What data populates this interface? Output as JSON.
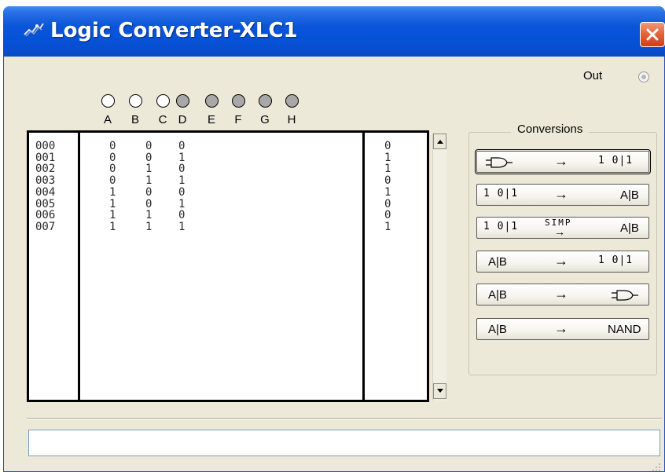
{
  "window": {
    "title": "Logic Converter-XLC1"
  },
  "output": {
    "label": "Out"
  },
  "inputs": [
    {
      "letter": "A",
      "state": "off"
    },
    {
      "letter": "B",
      "state": "off"
    },
    {
      "letter": "C",
      "state": "off"
    },
    {
      "letter": "D",
      "state": "on"
    },
    {
      "letter": "E",
      "state": "on"
    },
    {
      "letter": "F",
      "state": "on"
    },
    {
      "letter": "G",
      "state": "on"
    },
    {
      "letter": "H",
      "state": "on"
    }
  ],
  "truth_table": {
    "rows": [
      {
        "index": "000",
        "a": "0",
        "b": "0",
        "c": "0",
        "out": "0"
      },
      {
        "index": "001",
        "a": "0",
        "b": "0",
        "c": "1",
        "out": "1"
      },
      {
        "index": "002",
        "a": "0",
        "b": "1",
        "c": "0",
        "out": "1"
      },
      {
        "index": "003",
        "a": "0",
        "b": "1",
        "c": "1",
        "out": "0"
      },
      {
        "index": "004",
        "a": "1",
        "b": "0",
        "c": "0",
        "out": "1"
      },
      {
        "index": "005",
        "a": "1",
        "b": "0",
        "c": "1",
        "out": "0"
      },
      {
        "index": "006",
        "a": "1",
        "b": "1",
        "c": "0",
        "out": "0"
      },
      {
        "index": "007",
        "a": "1",
        "b": "1",
        "c": "1",
        "out": "1"
      }
    ]
  },
  "conversions": {
    "label": "Conversions",
    "truth_table_symbol": "1 0|1",
    "expression_symbol": "A|B",
    "simp_label": "SIMP",
    "nand_label": "NAND",
    "arrow": "→"
  },
  "expression": {
    "value": ""
  },
  "colors": {
    "titlebar": "#0552d6",
    "window_bg": "#ece9d8",
    "close": "#e2613a"
  }
}
